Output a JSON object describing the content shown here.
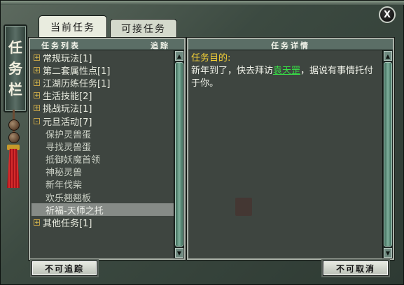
{
  "window": {
    "side_title": [
      "任",
      "务",
      "栏"
    ],
    "close_label": "X"
  },
  "tabs": [
    {
      "label": "当前任务",
      "active": true
    },
    {
      "label": "可接任务",
      "active": false
    }
  ],
  "list_panel": {
    "header_title": "任务列表",
    "header_action": "追踪",
    "items": [
      {
        "label": "常规玩法[1]",
        "expander": "+"
      },
      {
        "label": "第二套属性点[1]",
        "expander": "+"
      },
      {
        "label": "江湖历练任务[1]",
        "expander": "+"
      },
      {
        "label": "生活技能[2]",
        "expander": "+"
      },
      {
        "label": "挑战玩法[1]",
        "expander": "+"
      },
      {
        "label": "元旦活动[7]",
        "expander": "-"
      },
      {
        "label": "保护灵兽蛋",
        "child": true
      },
      {
        "label": "寻找灵兽蛋",
        "child": true
      },
      {
        "label": "抵御妖魔首领",
        "child": true
      },
      {
        "label": "神秘灵兽",
        "child": true
      },
      {
        "label": "新年伐柴",
        "child": true
      },
      {
        "label": "欢乐翘翘板",
        "child": true
      },
      {
        "label": "祈福-天师之托",
        "child": true,
        "selected": true
      },
      {
        "label": "其他任务[1]",
        "expander": "+"
      }
    ]
  },
  "detail_panel": {
    "header_title": "任务详情",
    "objective_label": "任务目的:",
    "text_before": "新年到了，快去拜访",
    "npc_link": "袁天罡",
    "text_after": "，据说有事情托付于你。"
  },
  "buttons": {
    "track": "不可追踪",
    "cancel": "不可取消"
  },
  "colors": {
    "objective": "#f2cf36",
    "link": "#38e046",
    "selected_row": "#868b87"
  }
}
